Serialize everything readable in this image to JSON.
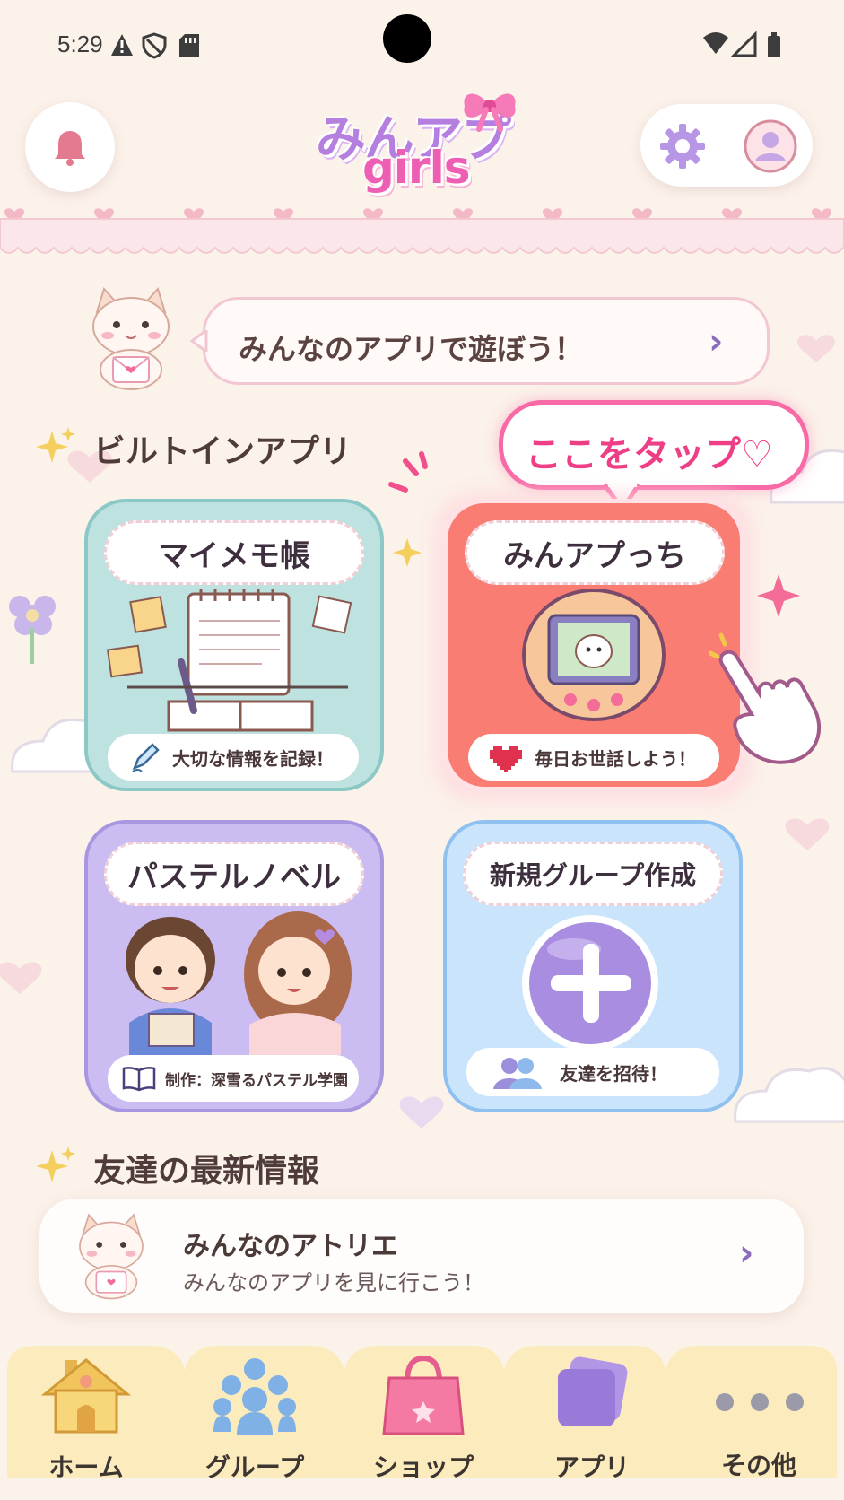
{
  "status_bar": {
    "time": "5:29"
  },
  "header": {
    "logo_line1": "みんアプ",
    "logo_line2": "girls",
    "bell_icon": "bell-icon",
    "settings_icon": "gear-icon",
    "profile_icon": "user-icon"
  },
  "banner": {
    "text": "みんなのアプリで遊ぼう！",
    "chevron": "›"
  },
  "builtin": {
    "title": "ビルトインアプリ",
    "tap_hint": "ここをタップ♡",
    "cards": [
      {
        "title": "マイメモ帳",
        "caption": "大切な情報を記録！"
      },
      {
        "title": "みんアプっち",
        "caption": "毎日お世話しよう！"
      },
      {
        "title": "パステルノベル",
        "caption": "制作：深雪るパステル学園"
      },
      {
        "title": "新規グループ作成",
        "caption": "友達を招待！"
      }
    ]
  },
  "friends": {
    "title": "友達の最新情報",
    "item": {
      "title": "みんなのアトリエ",
      "subtitle": "みんなのアプリを見に行こう！",
      "chevron": "›"
    }
  },
  "nav": {
    "items": [
      {
        "label": "ホーム",
        "icon": "house-icon"
      },
      {
        "label": "グループ",
        "icon": "group-icon"
      },
      {
        "label": "ショップ",
        "icon": "shopping-bag-icon"
      },
      {
        "label": "アプリ",
        "icon": "apps-icon"
      },
      {
        "label": "その他",
        "icon": "more-dots-icon"
      }
    ]
  },
  "colors": {
    "background": "#fbf2ea",
    "memo_card": "#bfe3e0",
    "pet_card": "#f97d72",
    "novel_card": "#cbbdf2",
    "group_card": "#c9e4fb",
    "accent_pink": "#ee3f86",
    "accent_purple": "#9b7fdc"
  }
}
